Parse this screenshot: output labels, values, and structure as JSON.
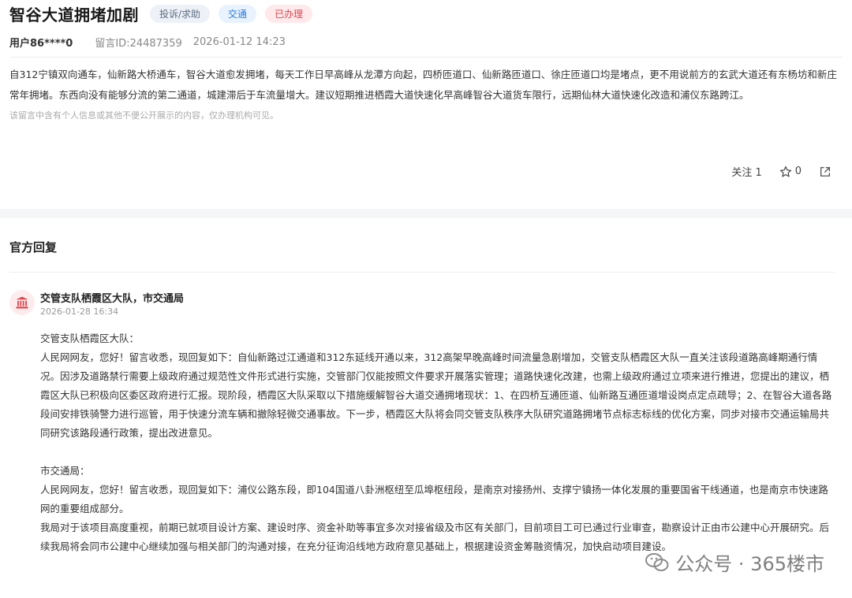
{
  "post": {
    "title": "智谷大道拥堵加剧",
    "tags": [
      "投诉/求助",
      "交通",
      "已办理"
    ],
    "user": "用户86****0",
    "message_id": "留言ID:24487359",
    "time": "2026-01-12 14:23",
    "content": "自312宁镇双向通车，仙新路大桥通车，智谷大道愈发拥堵，每天工作日早高峰从龙潭方向起，四桥匝道口、仙新路匝道口、徐庄匝道口均是堵点，更不用说前方的玄武大道还有东杨坊和新庄常年拥堵。东西向没有能够分流的第二通道，城建滞后于车流量增大。建议短期推进栖霞大道快速化早高峰智谷大道货车限行，远期仙林大道快速化改造和浦仪东路跨江。",
    "privacy_note": "该留言中含有个人信息或其他不便公开展示的内容，仅办理机构可见。"
  },
  "actions": {
    "follow_label": "关注 1",
    "star_count": "0"
  },
  "reply": {
    "section_title": "官方回复",
    "org_name": "交管支队栖霞区大队，市交通局",
    "time": "2026-01-28 16:34",
    "para1_head": "交管支队栖霞区大队：",
    "para1": "人民网网友，您好！留言收悉，现回复如下：自仙新路过江通道和312东延线开通以来，312高架早晚高峰时间流量急剧增加，交管支队栖霞区大队一直关注该段道路高峰期通行情况。因涉及道路禁行需要上级政府通过规范性文件形式进行实施，交管部门仅能按照文件要求开展落实管理；道路快速化改建，也需上级政府通过立项来进行推进，您提出的建议，栖霞区大队已积极向区委区政府进行汇报。现阶段，栖霞区大队采取以下措施缓解智谷大道交通拥堵现状：1、在四桥互通匝道、仙新路互通匝道增设岗点定点疏导；2、在智谷大道各路段间安排铁骑警力进行巡管，用于快速分流车辆和撤除轻微交通事故。下一步，栖霞区大队将会同交管支队秩序大队研究道路拥堵节点标志标线的优化方案，同步对接市交通运输局共同研究该路段通行政策，提出改进意见。",
    "para2_head": "市交通局：",
    "para2": "人民网网友，您好！留言收悉，现回复如下：浦仪公路东段，即104国道八卦洲枢纽至瓜埠枢纽段，是南京对接扬州、支撑宁镇扬一体化发展的重要国省干线通道，也是南京市快速路网的重要组成部分。",
    "para3": "我局对于该项目高度重视，前期已就项目设计方案、建设时序、资金补助等事宜多次对接省级及市区有关部门，目前项目工可已通过行业审查，勘察设计正由市公建中心开展研究。后续我局将会同市公建中心继续加强与相关部门的沟通对接，在充分征询沿线地方政府意见基础上，根据建设资金筹融资情况，加快启动项目建设。"
  },
  "watermark": {
    "text": "公众号 · 365楼市",
    "icon": "wechat-icon"
  },
  "colors": {
    "tag_red": "#e0464f",
    "tag_blue": "#2a7ad8",
    "org_icon": "#e0464f"
  }
}
